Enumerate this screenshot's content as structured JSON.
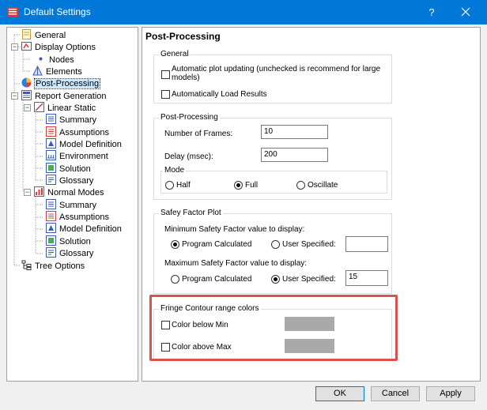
{
  "window": {
    "title": "Default Settings",
    "help_label": "?"
  },
  "tree": {
    "items": [
      {
        "label": "General"
      },
      {
        "label": "Display Options"
      },
      {
        "label": "Nodes"
      },
      {
        "label": "Elements"
      },
      {
        "label": "Post-Processing"
      },
      {
        "label": "Report Generation"
      },
      {
        "label": "Linear Static"
      },
      {
        "label": "Summary"
      },
      {
        "label": "Assumptions"
      },
      {
        "label": "Model Definition"
      },
      {
        "label": "Environment"
      },
      {
        "label": "Solution"
      },
      {
        "label": "Glossary"
      },
      {
        "label": "Normal Modes"
      },
      {
        "label": "Summary"
      },
      {
        "label": "Assumptions"
      },
      {
        "label": "Model Definition"
      },
      {
        "label": "Solution"
      },
      {
        "label": "Glossary"
      },
      {
        "label": "Tree Options"
      }
    ]
  },
  "panel": {
    "header": "Post-Processing",
    "general": {
      "title": "General",
      "auto_plot_label": "Automatic plot updating (unchecked is recommend for large models)",
      "auto_load_label": "Automatically Load Results"
    },
    "postproc": {
      "title": "Post-Processing",
      "frames_label": "Number of Frames:",
      "frames_value": "10",
      "delay_label": "Delay (msec):",
      "delay_value": "200",
      "mode": {
        "title": "Mode",
        "half": "Half",
        "full": "Full",
        "oscillate": "Oscillate"
      }
    },
    "safety": {
      "title": "Safey Factor Plot",
      "min_label": "Minimum Safety Factor value to display:",
      "max_label": "Maximum Safety Factor value to display:",
      "program_calculated": "Program Calculated",
      "user_specified": "User Specified:",
      "min_value": "",
      "max_value": "15"
    },
    "fringe": {
      "title": "Fringe Contour range colors",
      "below_min": "Color below Min",
      "above_max": "Color above Max"
    }
  },
  "footer": {
    "ok": "OK",
    "cancel": "Cancel",
    "apply": "Apply"
  },
  "colors": {
    "titlebar": "#0078d7",
    "selected": "#cce8ff",
    "highlight": "#d9534f",
    "swatch": "#a9a9a9"
  }
}
